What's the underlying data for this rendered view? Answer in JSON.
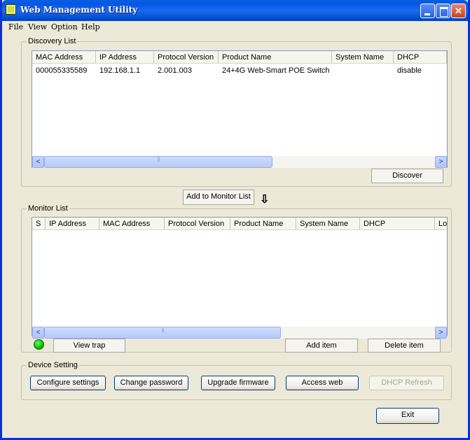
{
  "window": {
    "title": "Web Management Utility",
    "buttons": [
      "minimize",
      "maximize",
      "close"
    ]
  },
  "menu": [
    "File",
    "View",
    "Option",
    "Help"
  ],
  "discovery": {
    "label": "Discovery List",
    "columns": [
      "MAC Address",
      "IP Address",
      "Protocol Version",
      "Product Name",
      "System Name",
      "DHCP"
    ],
    "rows": [
      [
        "000055335589",
        "192.168.1.1",
        "2.001.003",
        "24+4G Web-Smart POE Switch ...",
        "",
        "disable"
      ]
    ],
    "discover_button": "Discover"
  },
  "add_to_monitor_button": "Add to Monitor List",
  "monitor": {
    "label": "Monitor List",
    "columns": [
      "S",
      "IP Address",
      "MAC Address",
      "Protocol Version",
      "Product Name",
      "System Name",
      "DHCP",
      "Lo"
    ],
    "view_trap_button": "View trap",
    "add_item_button": "Add item",
    "delete_item_button": "Delete item",
    "status_color": "#00c800"
  },
  "device_setting": {
    "label": "Device Setting",
    "buttons": {
      "configure": "Configure settings",
      "change_password": "Change password",
      "upgrade_firmware": "Upgrade firmware",
      "access_web": "Access web",
      "dhcp_refresh": "DHCP Refresh"
    }
  },
  "exit_button": "Exit"
}
